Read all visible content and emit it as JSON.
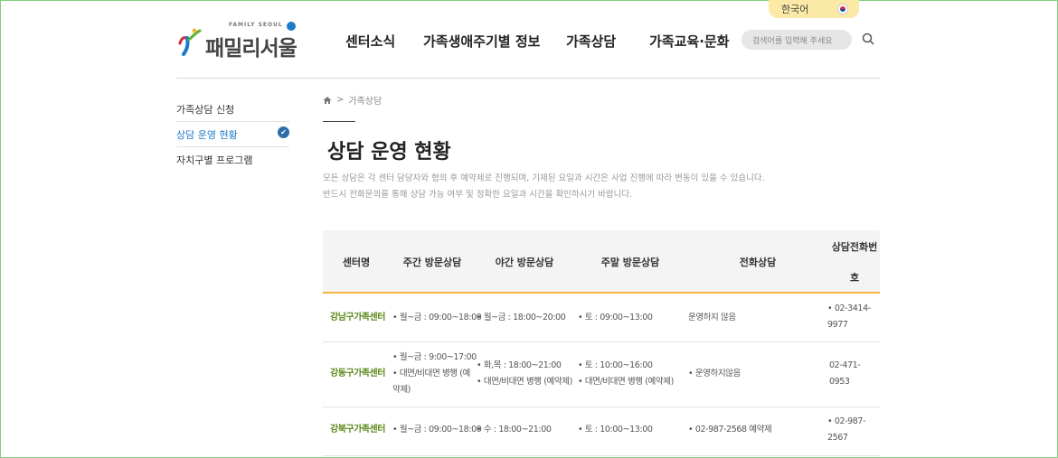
{
  "lang": {
    "label": "한국어"
  },
  "logo": {
    "small": "FAMILY SEOUL",
    "text": "패밀리서울"
  },
  "gnb": [
    "센터소식",
    "가족생애주기별 정보",
    "가족상담",
    "가족교육·문화"
  ],
  "search": {
    "placeholder": "검색어를 입력해 주세요"
  },
  "lnb": [
    "가족상담 신청",
    "상담 운영 현황",
    "자치구별 프로그램"
  ],
  "breadcrumb": {
    "sep": ">",
    "current": "가족상담"
  },
  "page": {
    "title": "상담 운영 현황",
    "desc1": "모든 상담은 각 센터 담당자와 협의 후 예약제로 진행되며, 기재된 요일과 시간은 사업 진행에 따라 변동이 있을 수 있습니다.",
    "desc2": "반드시 전화문의를 통해 상담 가능 여부 및 정확한 요일과 시간을 확인하시기 바랍니다."
  },
  "table": {
    "headers": [
      "센터명",
      "주간 방문상담",
      "야간 방문상담",
      "주말 방문상담",
      "전화상담",
      "상담전화번",
      "호"
    ],
    "rows": [
      {
        "center": "강남구가족센터",
        "day": [
          "• 월~금 : 09:00~18:00"
        ],
        "night": [
          "• 월~금 : 18:00~20:00"
        ],
        "weekend": [
          "• 토 : 09:00~13:00"
        ],
        "phone_counsel": [
          "운영하지 않음"
        ],
        "tel": [
          "• 02-3414-",
          "9977"
        ]
      },
      {
        "center": "강동구가족센터",
        "day": [
          "• 월~금 : 9:00~17:00",
          "• 대면/비대면 병행 (예",
          "약제)"
        ],
        "night": [
          "• 화,목 : 18:00~21:00",
          "• 대면/비대면 병행 (예약제)"
        ],
        "weekend": [
          "• 토 : 10:00~16:00",
          "• 대면/비대면 병행 (예약제)"
        ],
        "phone_counsel": [
          "• 운영하지않음"
        ],
        "tel": [
          "02-471-",
          "0953"
        ]
      },
      {
        "center": "강북구가족센터",
        "day": [
          "• 월~금 : 09:00~18:00"
        ],
        "night": [
          "• 수 : 18:00~21:00"
        ],
        "weekend": [
          "• 토 : 10:00~13:00"
        ],
        "phone_counsel": [
          "• 02-987-2568 예약제"
        ],
        "tel": [
          "• 02-987-",
          "2567"
        ]
      }
    ]
  },
  "colors": {
    "accent": "#1e7ac9",
    "center_name": "#5c8a1e",
    "table_border": "#f4b63f",
    "lang_bg": "#fbe9a6"
  }
}
